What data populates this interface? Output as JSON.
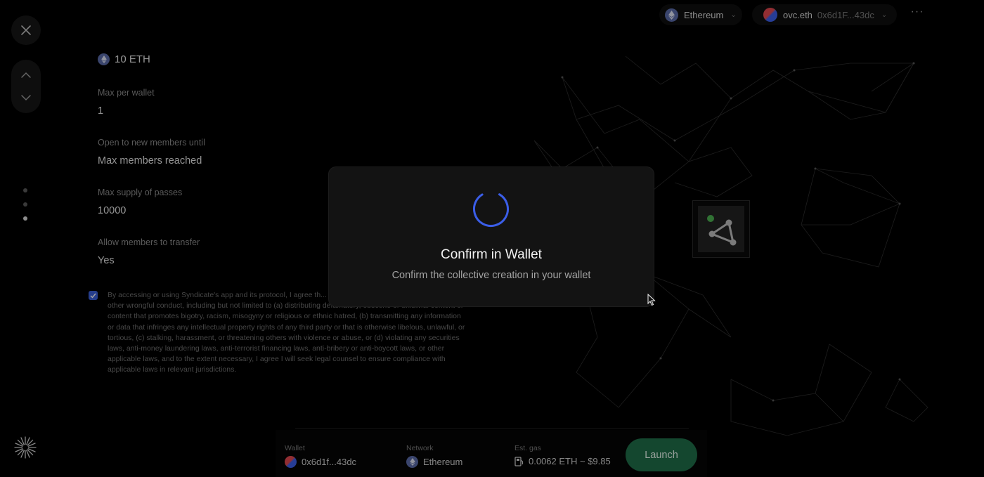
{
  "header": {
    "network": {
      "label": "Ethereum",
      "icon": "ethereum-icon"
    },
    "account": {
      "ens": "ovc.eth",
      "address": "0x6d1F...43dc"
    },
    "more_icon": "more-icon"
  },
  "left_rail": {
    "close_icon": "close-icon",
    "up_icon": "chevron-up-icon",
    "down_icon": "chevron-down-icon",
    "steps": 3,
    "active_step": 3,
    "logo_icon": "syndicate-logo-icon"
  },
  "summary": {
    "price": "10 ETH",
    "fields": [
      {
        "label": "Max per wallet",
        "value": "1"
      },
      {
        "label": "Open to new members until",
        "value": "Max members reached"
      },
      {
        "label": "Max supply of passes",
        "value": "10000"
      },
      {
        "label": "Allow members to transfer",
        "value": "Yes"
      }
    ]
  },
  "terms": {
    "checked": true,
    "text": "By accessing or using Syndicate's app and its protocol, I agree th... protocol to engage in illegal, fraudulent or other wrongful conduct, including but not limited to (a) distributing defamatory, obscene or unlawful content or content that promotes bigotry, racism, misogyny or religious or ethnic hatred, (b) transmitting any information or data that infringes any intellectual property rights of any third party or that is otherwise libelous, unlawful, or tortious, (c) stalking, harassment, or threatening others with violence or abuse, or (d) violating any securities laws, anti-money laundering laws, anti-terrorist financing laws, anti-bribery or anti-boycott laws, or other applicable laws, and to the extent necessary, I agree I will seek legal counsel to ensure compliance with applicable laws in relevant jurisdictions."
  },
  "bottom_bar": {
    "wallet_label": "Wallet",
    "wallet_value": "0x6d1f...43dc",
    "network_label": "Network",
    "network_value": "Ethereum",
    "gas_label": "Est. gas",
    "gas_value": "0.0062 ETH ~ $9.85",
    "launch_label": "Launch"
  },
  "modal": {
    "title": "Confirm in Wallet",
    "subtitle": "Confirm the collective creation in your wallet",
    "icon": "spinner-icon"
  },
  "colors": {
    "accent_blue": "#3b5ee8",
    "launch_green": "#1f6e49",
    "background": "#000000",
    "modal_bg": "#131313"
  }
}
